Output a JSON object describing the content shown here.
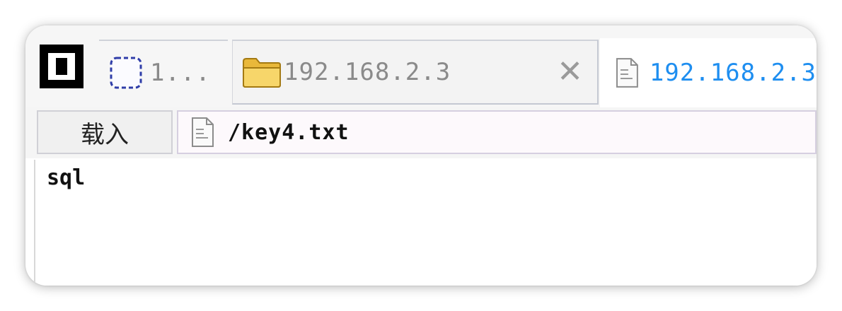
{
  "tabs": [
    {
      "label": "1...",
      "icon": "selection-icon"
    },
    {
      "label": "192.168.2.3",
      "icon": "folder-icon",
      "close_label": "✕"
    },
    {
      "label": "192.168.2.3",
      "icon": "document-icon",
      "active": true
    }
  ],
  "toolbar": {
    "load_label": "载入",
    "path_value": "/key4.txt",
    "path_icon": "document-icon"
  },
  "editor": {
    "content": "sql"
  },
  "colors": {
    "active_tab_text": "#1e8ef0",
    "inactive_tab_text": "#8a8a8a",
    "folder": "#f2c84b"
  }
}
